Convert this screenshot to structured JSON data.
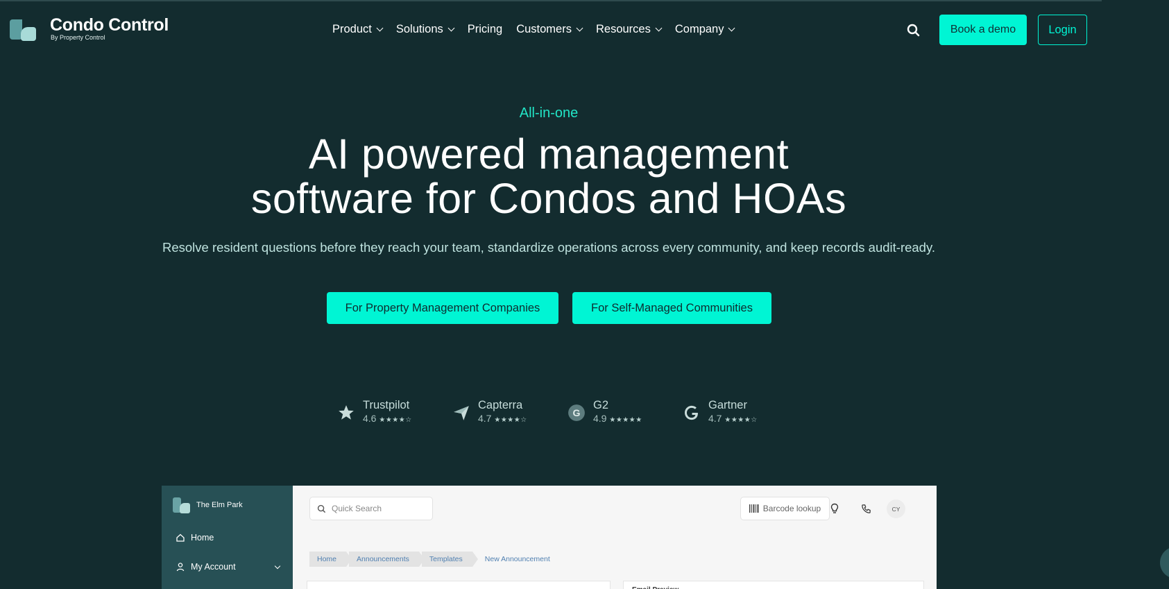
{
  "header": {
    "brand_name": "Condo Control",
    "brand_sub": "By Property Control",
    "nav": [
      {
        "label": "Product",
        "has_dropdown": true
      },
      {
        "label": "Solutions",
        "has_dropdown": true
      },
      {
        "label": "Pricing",
        "has_dropdown": false
      },
      {
        "label": "Customers",
        "has_dropdown": true
      },
      {
        "label": "Resources",
        "has_dropdown": true
      },
      {
        "label": "Company",
        "has_dropdown": true
      }
    ],
    "book_demo": "Book a demo",
    "login": "Login"
  },
  "hero": {
    "eyebrow": "All-in-one",
    "headline_line1": "AI powered management",
    "headline_line2": "software for Condos and HOAs",
    "subhead": "Resolve resident questions before they reach your team, standardize operations across every community, and keep records audit-ready.",
    "cta_primary": "For Property Management Companies",
    "cta_secondary": "For Self-Managed Communities"
  },
  "ratings": [
    {
      "name": "Trustpilot",
      "score": "4.6",
      "icon": "star-icon"
    },
    {
      "name": "Capterra",
      "score": "4.7",
      "icon": "paper-plane-icon"
    },
    {
      "name": "G2",
      "score": "4.9",
      "icon": "g2-logo-icon"
    },
    {
      "name": "Gartner",
      "score": "4.7",
      "icon": "google-g-icon"
    }
  ],
  "preview": {
    "community": "The Elm Park",
    "nav_home": "Home",
    "nav_account": "My Account",
    "search_placeholder": "Quick Search",
    "barcode": "Barcode lookup",
    "avatar": "CY",
    "breadcrumbs": [
      "Home",
      "Announcements",
      "Templates",
      "New Announcement"
    ],
    "card_title": "Email Preview"
  },
  "colors": {
    "background": "#132c2f",
    "accent": "#00f5d4",
    "eyebrow": "#22e6c7"
  }
}
